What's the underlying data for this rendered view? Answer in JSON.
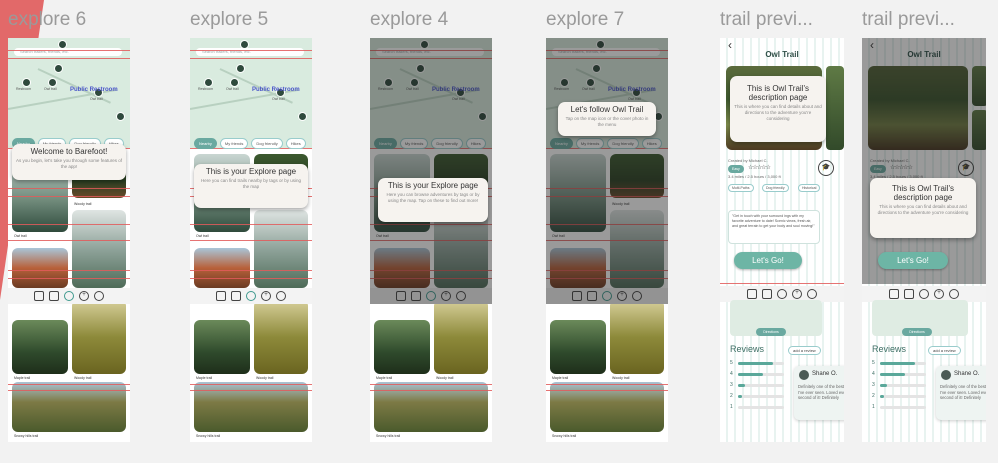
{
  "frames": {
    "explore6": {
      "title": "explore 6"
    },
    "explore5": {
      "title": "explore 5"
    },
    "explore4": {
      "title": "explore 4"
    },
    "explore7": {
      "title": "explore 7"
    },
    "trail1": {
      "title": "trail previ..."
    },
    "trail2": {
      "title": "trail previ..."
    }
  },
  "map": {
    "search_placeholder": "Search trailers, friends, etc.",
    "public_restroom": "Public Restroom",
    "pin_labels": [
      "Restroom",
      "Owl trail",
      "Owl trail"
    ]
  },
  "chips": [
    "Nearby",
    "My friends",
    "Dog friendly",
    "Hikes"
  ],
  "trails": {
    "owl": "Owl trail",
    "woody": "Woody trail",
    "red_rock": "Red Rock mountain trail",
    "mountain": "Mountain the clays",
    "maple": "Maple trail",
    "snowy": "Snowy hills trail"
  },
  "tips": {
    "welcome_title": "Welcome to Barefoot!",
    "welcome_body": "As you begin, let's take you through some features of the app!",
    "explore_title": "This is your Explore page",
    "explore_body": "Here you can find trails nearby by tags or by using the map",
    "explore_body2": "Here you can browse adventures by tags or by using the map. Tap on these to find out more!",
    "follow_title": "Let's follow Owl Trail",
    "follow_body": "Tap on the map icon or the cover photo in the menu",
    "desc_title": "This is Owl Trail's description page",
    "desc_body": "This is where you can find details about and directions to the adventure you're considering"
  },
  "trail": {
    "title": "Owl Trail",
    "created_by": "Created by Michael C.",
    "badge": "Easy",
    "stars": "☆☆☆☆☆",
    "stats": "3.4 miles / 2.5 hours / 3,000 ft",
    "tags": [
      "Multi-Paths",
      "Dog friendly",
      "Historical"
    ],
    "quote": "\"Get in touch with your surround ings with my favorite adventure to date! Scenic views, fresh air, and great terrain to get your body and soul moving!\"",
    "lets_go": "Let's Go!",
    "directions": "Directions",
    "reviews": "Reviews",
    "add_review": "add a review",
    "rating_labels": [
      "5",
      "4",
      "3",
      "2",
      "1"
    ],
    "rating_levels": [
      0.75,
      0.55,
      0.15,
      0.08,
      0.0
    ],
    "reviewer": "Shane O.",
    "review_text": "Definitely one of the best trails I've ever seen. Loved every second of it! Definitely"
  },
  "colors": {
    "accent": "#6aa9a0",
    "redline": "#e25a5a",
    "corner": "#e05a5a"
  }
}
